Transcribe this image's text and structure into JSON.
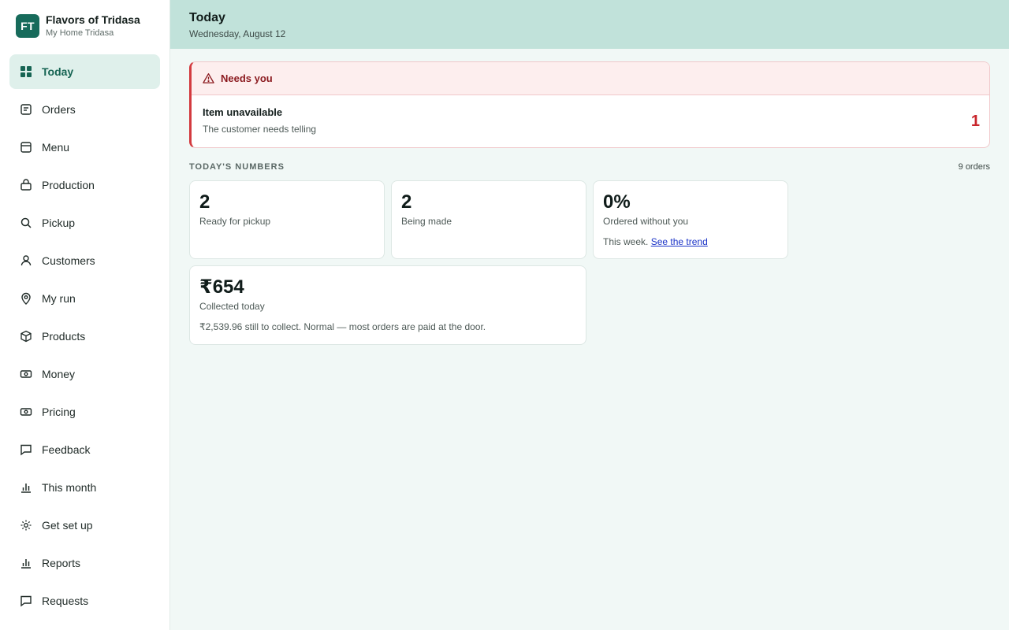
{
  "brand": {
    "initials": "FT",
    "name": "Flavors of Tridasa",
    "subtitle": "My Home Tridasa",
    "color": "#176b5b"
  },
  "sidebar": {
    "items": [
      {
        "label": "Today",
        "icon": "grid-icon",
        "active": true
      },
      {
        "label": "Orders",
        "icon": "orders-icon"
      },
      {
        "label": "Menu",
        "icon": "menu-icon"
      },
      {
        "label": "Production",
        "icon": "bag-icon"
      },
      {
        "label": "Pickup",
        "icon": "search-icon"
      },
      {
        "label": "Customers",
        "icon": "user-icon"
      },
      {
        "label": "My run",
        "icon": "location-pin-icon"
      },
      {
        "label": "Products",
        "icon": "box-icon"
      },
      {
        "label": "Money",
        "icon": "money-icon"
      },
      {
        "label": "Pricing",
        "icon": "pricing-icon"
      },
      {
        "label": "Feedback",
        "icon": "chat-icon"
      },
      {
        "label": "This month",
        "icon": "bar-chart-icon"
      },
      {
        "label": "Get set up",
        "icon": "gear-icon"
      },
      {
        "label": "Reports",
        "icon": "bar-chart-icon"
      },
      {
        "label": "Requests",
        "icon": "chat-icon"
      }
    ]
  },
  "header": {
    "title": "Today",
    "date": "Wednesday, August 12"
  },
  "alert": {
    "title": "Needs you",
    "item_title": "Item unavailable",
    "item_sub": "The customer needs telling",
    "count": "1"
  },
  "numbers": {
    "label": "TODAY'S NUMBERS",
    "count": "9 orders",
    "cards": [
      {
        "value": "2",
        "label": "Ready for pickup"
      },
      {
        "value": "2",
        "label": "Being made"
      },
      {
        "value": "0%",
        "label": "Ordered without you",
        "note": "This week.",
        "link": "See the trend"
      },
      {
        "value": "₹654",
        "label": "Collected today",
        "note": "₹2,539.96 still to collect. Normal — most orders are paid at the door."
      }
    ]
  },
  "colors": {
    "accent": "#176b5b",
    "header_bg": "#c1e2da",
    "alert_red": "#d33a3f",
    "page_bg": "#f1f8f6"
  }
}
